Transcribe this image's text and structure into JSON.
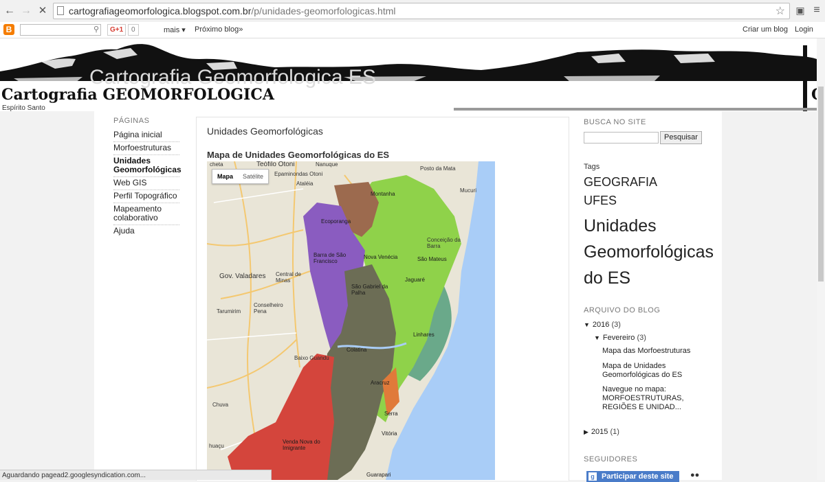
{
  "browser": {
    "url_host": "cartografiageomorfologica.blogspot.com.br",
    "url_path": "/p/unidades-geomorfologicas.html"
  },
  "navbar": {
    "gplus": "G+1",
    "gplus_count": "0",
    "more": "mais ▾",
    "next_blog": "Próximo blog»",
    "create_blog": "Criar um blog",
    "login": "Login"
  },
  "header": {
    "title": "Cartografia GEOMORFOLOGICA",
    "ghost_title": "Cartografia Geomorfologica ES",
    "description": "Espírito Santo",
    "title_right": "C"
  },
  "pages": {
    "heading": "PÁGINAS",
    "items": [
      "Página inicial",
      "Morfoestruturas",
      "Unidades Geomorfológicas",
      "Web GIS",
      "Perfil Topográfico",
      "Mapeamento colaborativo",
      "Ajuda"
    ]
  },
  "post": {
    "title": "Unidades Geomorfológicas",
    "subtitle": "Mapa de Unidades Geomorfológicas do ES",
    "map_tabs": [
      "Mapa",
      "Satélite"
    ],
    "map_labels": {
      "teofilo": "Teófilo Otoni",
      "nanuque": "Nanuque",
      "posto": "Posto da Mata",
      "mucuri": "Mucuri",
      "montanha": "Montanha",
      "ecoporanga": "Ecoporanga",
      "barra": "Barra de São Francisco",
      "nova_venecia": "Nova Venécia",
      "sao_mateus": "São Mateus",
      "conceicao": "Conceição da Barra",
      "gov": "Gov. Valadares",
      "sao_gabriel": "São Gabriel da Palha",
      "jaguare": "Jaguaré",
      "linhares": "Linhares",
      "colatina": "Colatina",
      "aracruz": "Aracruz",
      "serra": "Serra",
      "vitoria": "Vitória",
      "venda": "Venda Nova do Imigrante",
      "conselheiro": "Conselheiro Pena",
      "baixo": "Baixo Guandu",
      "huacu": "huaçu",
      "tarumirim": "Tarumirim",
      "ataleia": "Ataléia",
      "epaminondas": "Epaminondas Otoni",
      "central": "Central de Minas",
      "chuva": "Chuva",
      "guarapari": "Guarapari",
      "cheta": "cheta"
    }
  },
  "sidebar": {
    "search_heading": "BUSCA NO SITE",
    "search_button": "Pesquisar",
    "tags_label": "Tags",
    "tags": [
      "GEOGRAFIA",
      "UFES",
      "Unidades Geomorfológicas do ES"
    ],
    "archive_heading": "ARQUIVO DO BLOG",
    "year2016": "2016",
    "year2016_count": "(3)",
    "month": "Fevereiro",
    "month_count": "(3)",
    "posts": [
      "Mapa das Morfoestruturas",
      "Mapa de Unidades Geomorfológicas do ES",
      "Navegue no mapa: MORFOESTRUTURAS, REGIÕES E UNIDAD..."
    ],
    "year2015": "2015",
    "year2015_count": "(1)",
    "followers_heading": "SEGUIDORES",
    "join_button": "Participar deste site"
  },
  "status": "Aguardando pagead2.googlesyndication.com...",
  "colors": {
    "light_green": "#8fd24a",
    "brown": "#9c6a4e",
    "purple": "#8a5cc0",
    "dark_olive": "#6c6d55",
    "red": "#d4453c",
    "teal": "#6aa98a",
    "sea": "#a9cdf7"
  }
}
